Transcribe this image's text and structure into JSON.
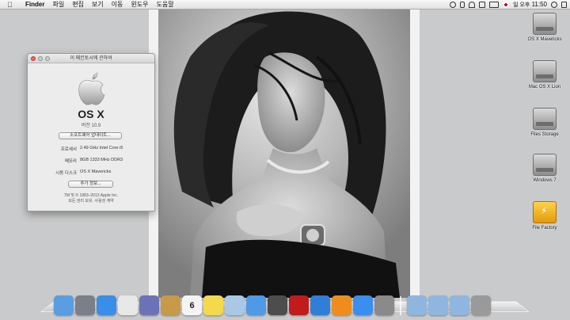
{
  "menubar": {
    "app_name": "Finder",
    "menus": [
      "파일",
      "편집",
      "보기",
      "이동",
      "윈도우",
      "도움말"
    ],
    "clock_prefix": "일 오후",
    "clock_time": "11:50",
    "icons": [
      "time-machine-icon",
      "bluetooth-icon",
      "wifi-icon",
      "volume-icon",
      "battery-icon",
      "input-flag-icon",
      "spotlight-icon",
      "notification-icon"
    ]
  },
  "about_window": {
    "title": "이 매킨토시에 관하여",
    "os_name": "OS X",
    "version": "버전 10.9",
    "update_button": "소프트웨어 업데이트...",
    "rows": [
      {
        "key": "프로세서",
        "value": "2.49 GHz Intel Core i5"
      },
      {
        "key": "메모리",
        "value": "8GB 1333 MHz DDR3"
      },
      {
        "key": "시동 디스크",
        "value": "OS X Mavericks"
      }
    ],
    "more_info_button": "추가 정보...",
    "copyright_line1": "TM 및 © 1983–2013 Apple Inc.",
    "copyright_line2": "모든 권리 보유. 사용권 계약"
  },
  "desktop_icons": [
    {
      "label": "OS X Mavericks",
      "kind": "hard-drive"
    },
    {
      "label": "Mac OS X Lion",
      "kind": "hard-drive"
    },
    {
      "label": "Files Storage",
      "kind": "hard-drive"
    },
    {
      "label": "Windows 7",
      "kind": "hard-drive"
    },
    {
      "label": "File Factory",
      "kind": "usb-drive"
    }
  ],
  "dock": {
    "apps": [
      {
        "name": "finder",
        "color": "#5a9de0"
      },
      {
        "name": "launchpad",
        "color": "#7a7f88"
      },
      {
        "name": "safari",
        "color": "#3a8ee6"
      },
      {
        "name": "chrome",
        "color": "#e8e8e8"
      },
      {
        "name": "preview-photo",
        "color": "#6b73b6"
      },
      {
        "name": "contacts",
        "color": "#c79a48"
      },
      {
        "name": "calendar",
        "color": "#f4f4f4"
      },
      {
        "name": "stickies",
        "color": "#f3d94b"
      },
      {
        "name": "preview",
        "color": "#a9c8e6"
      },
      {
        "name": "messages",
        "color": "#4f9ae6"
      },
      {
        "name": "facetime",
        "color": "#4d4d4d"
      },
      {
        "name": "photo-booth",
        "color": "#c21b1b"
      },
      {
        "name": "itunes",
        "color": "#2f7fd6"
      },
      {
        "name": "ibooks",
        "color": "#ef8c1e"
      },
      {
        "name": "app-store",
        "color": "#3b8ef0"
      },
      {
        "name": "system-preferences",
        "color": "#8a8a8a"
      }
    ],
    "stacks": [
      {
        "name": "applications-folder",
        "color": "#8fb6de"
      },
      {
        "name": "documents-folder",
        "color": "#8fb6de"
      },
      {
        "name": "downloads-folder",
        "color": "#8fb6de"
      },
      {
        "name": "trash",
        "color": "#9a9a9a"
      }
    ],
    "calendar_day": "6"
  }
}
